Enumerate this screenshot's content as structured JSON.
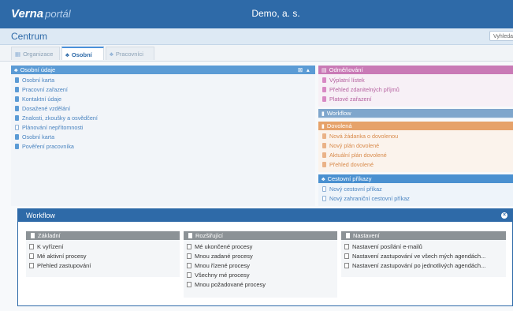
{
  "header": {
    "logo_main": "Verna",
    "logo_sub": "portál",
    "company": "Demo, a. s."
  },
  "page": {
    "title": "Centrum",
    "search_label": "Vyhleda"
  },
  "tabs": [
    {
      "label": "Organizace",
      "icon": "building-icon"
    },
    {
      "label": "Osobní",
      "icon": "person-icon"
    },
    {
      "label": "Pracovníci",
      "icon": "people-icon"
    }
  ],
  "osobni": {
    "title": "Osobní údaje",
    "items": [
      "Osobní karta",
      "Pracovní zařazení",
      "Kontaktní údaje",
      "Dosažené vzdělání",
      "Znalosti, zkoušky a osvědčení",
      "Plánování nepřítomnosti",
      "Osobní karta",
      "Pověření pracovníka"
    ]
  },
  "odmenovani": {
    "title": "Odměňování",
    "items": [
      "Výplatní lístek",
      "Přehled zdanitelných příjmů",
      "Platové zařazení"
    ]
  },
  "workflow_panel": {
    "title": "Workflow"
  },
  "dovolena": {
    "title": "Dovolená",
    "items": [
      "Nová žádanka o dovolenou",
      "Nový plán dovolené",
      "Aktuální plán dovolené",
      "Přehled dovolené"
    ]
  },
  "cestovni": {
    "title": "Cestovní příkazy",
    "items": [
      "Nový cestovní příkaz",
      "Nový zahraniční cestovní příkaz"
    ]
  },
  "workflow_dialog": {
    "title": "Workflow",
    "columns": [
      {
        "title": "Základní",
        "items": [
          "K vyřízení",
          "Mé aktivní procesy",
          "Přehled zastupování"
        ]
      },
      {
        "title": "Rozšiřující",
        "items": [
          "Mé ukončené procesy",
          "Mnou zadané procesy",
          "Mnou řízené procesy",
          "Všechny mé procesy",
          "Mnou požadované procesy"
        ]
      },
      {
        "title": "Nastavení",
        "items": [
          "Nastavení posílání e-mailů",
          "Nastavení zastupování ve všech mých agendách...",
          "Nastavení zastupování po jednotlivých agendách..."
        ]
      }
    ]
  },
  "colors": {
    "brand": "#2e6aa8",
    "osobni": "#5b9bd5",
    "odmenovani": "#c97ab6",
    "workflow": "#7fa6cc",
    "dovolena": "#e6a26a",
    "cestovni": "#4a90d0"
  }
}
